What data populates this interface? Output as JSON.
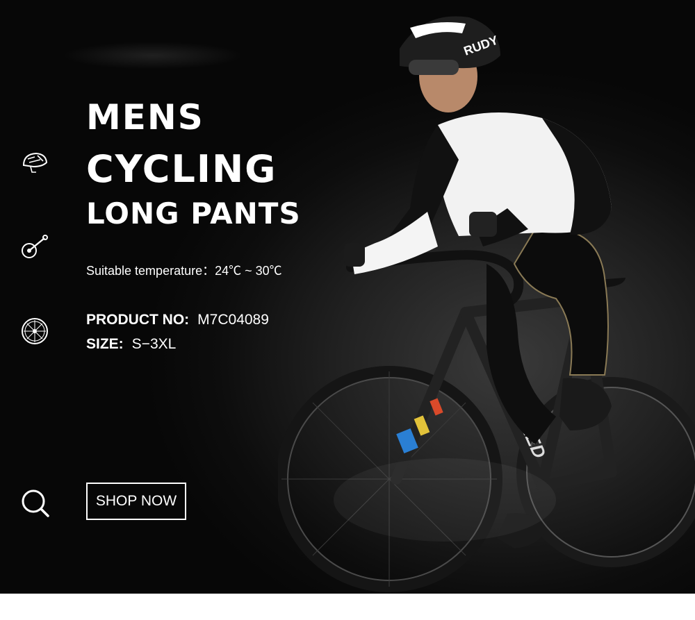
{
  "banner": {
    "title_line1": "MENS",
    "title_line2": "CYCLING",
    "title_line3": "LONG PANTS",
    "temperature_label": "Suitable temperature：",
    "temperature_value": "24℃ ~ 30℃",
    "product_no_label": "PRODUCT NO:",
    "product_no_value": "M7C04089",
    "size_label": "SIZE:",
    "size_value": "S−3XL",
    "shop_button": "SHOP NOW"
  },
  "photo": {
    "helmet_brand": "RUDY",
    "bike_brand": "SPECIALIZED"
  },
  "icons": [
    "helmet-icon",
    "bike-crank-icon",
    "wheel-icon",
    "search-icon"
  ],
  "colors": {
    "background": "#0d0d0d",
    "text": "#ffffff",
    "accent_blue": "#2a7fd4"
  }
}
